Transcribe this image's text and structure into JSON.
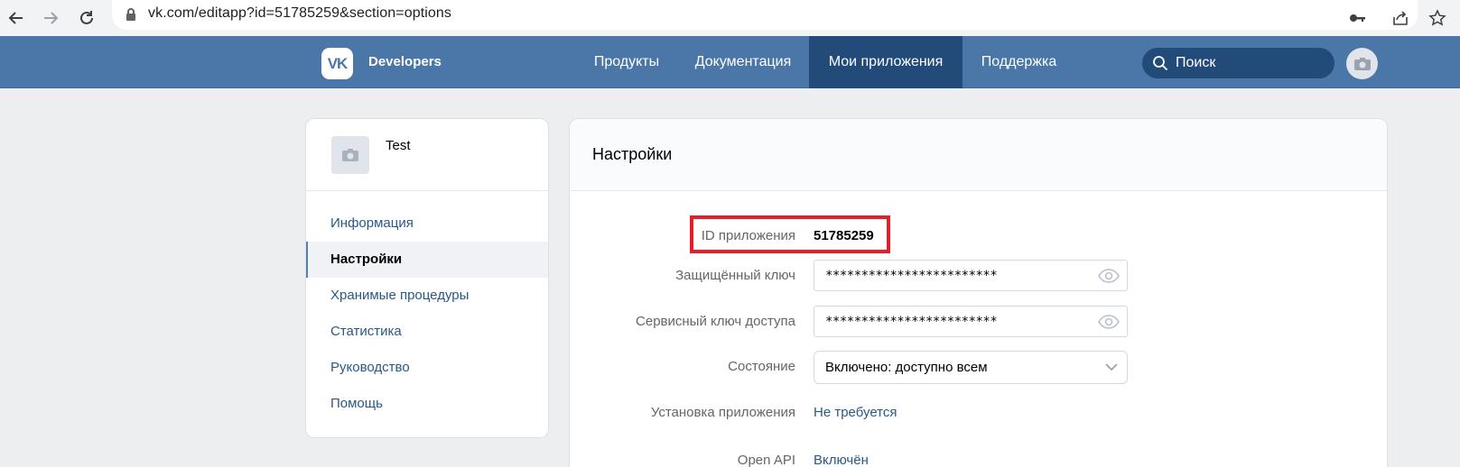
{
  "browser": {
    "url": "vk.com/editapp?id=51785259&section=options"
  },
  "header": {
    "logo_text": "VK",
    "brand": "Developers",
    "nav": [
      {
        "label": "Продукты"
      },
      {
        "label": "Документация"
      },
      {
        "label": "Мои приложения",
        "active": true
      },
      {
        "label": "Поддержка"
      }
    ],
    "search_placeholder": "Поиск"
  },
  "sidebar": {
    "app_name": "Test",
    "items": [
      {
        "label": "Информация"
      },
      {
        "label": "Настройки",
        "active": true
      },
      {
        "label": "Хранимые процедуры"
      },
      {
        "label": "Статистика"
      },
      {
        "label": "Руководство"
      },
      {
        "label": "Помощь"
      }
    ]
  },
  "settings": {
    "title": "Настройки",
    "app_id_label": "ID приложения",
    "app_id_value": "51785259",
    "secure_key_label": "Защищённый ключ",
    "secure_key_value": "************************",
    "service_key_label": "Сервисный ключ доступа",
    "service_key_value": "************************",
    "state_label": "Состояние",
    "state_value": "Включено: доступно всем",
    "install_label": "Установка приложения",
    "install_value": "Не требуется",
    "open_api_label": "Open API",
    "open_api_value": "Включён"
  },
  "colors": {
    "header_bg": "#4a76a8",
    "header_active": "#224b7a",
    "link": "#2a5885",
    "highlight": "#e3202a"
  }
}
